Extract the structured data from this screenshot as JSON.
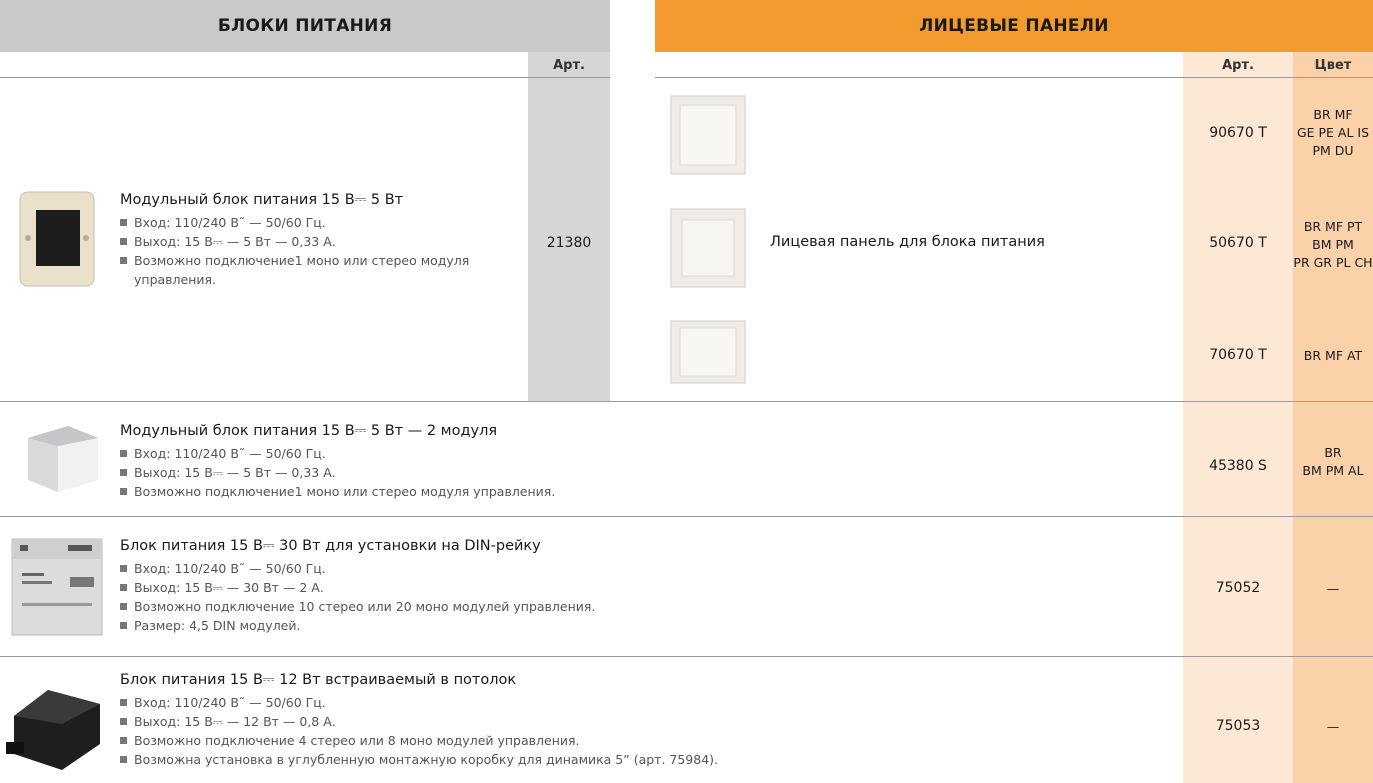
{
  "headers": {
    "left": "БЛОКИ ПИТАНИЯ",
    "right": "ЛИЦЕВЫЕ ПАНЕЛИ"
  },
  "col_heads": {
    "art_left": "Арт.",
    "art_right": "Арт.",
    "color": "Цвет"
  },
  "row1": {
    "title": "Модульный блок питания 15 В⎓ 5 Вт",
    "bullets": [
      "Вход: 110/240 В˜ — 50/60 Гц.",
      "Выход: 15 В⎓ — 5 Вт — 0,33 А.",
      "Возможно подключение1 моно или стерео модуля управления."
    ],
    "art": "21380",
    "panel_label": "Лицевая панель для блока питания",
    "panels": [
      {
        "art": "90670 T",
        "colors": [
          "BR MF",
          "GE PE AL IS",
          "PM DU"
        ]
      },
      {
        "art": "50670 T",
        "colors": [
          "BR MF PT",
          "BM PM",
          "PR GR PL CH"
        ]
      },
      {
        "art": "70670 T",
        "colors": [
          "BR MF AT"
        ]
      }
    ]
  },
  "row2": {
    "title": "Модульный блок питания 15 В⎓ 5 Вт — 2 модуля",
    "bullets": [
      "Вход: 110/240 В˜ — 50/60 Гц.",
      "Выход: 15 В⎓ — 5 Вт — 0,33 А.",
      "Возможно подключение1 моно или стерео модуля управления."
    ],
    "art": "45380 S",
    "colors": [
      "BR",
      "BM PM AL"
    ]
  },
  "row3": {
    "title": "Блок питания 15 В⎓ 30 Вт для установки на DIN-рейку",
    "bullets": [
      "Вход: 110/240 В˜ — 50/60 Гц.",
      "Выход: 15 В⎓ — 30 Вт — 2 А.",
      "Возможно подключение 10 стерео или 20 моно модулей управления.",
      "Размер: 4,5 DIN модулей."
    ],
    "art": "75052",
    "colors": [
      "—"
    ]
  },
  "row4": {
    "title": "Блок питания 15 В⎓ 12 Вт встраиваемый в потолок",
    "bullets": [
      "Вход: 110/240 В˜ — 50/60 Гц.",
      "Выход: 15 В⎓ — 12 Вт — 0,8 А.",
      "Возможно подключение 4 стерео или 8 моно модулей управления.",
      "Возможна установка в углубленную монтажную коробку для динамика 5” (арт. 75984)."
    ],
    "art": "75053",
    "colors": [
      "—"
    ]
  }
}
